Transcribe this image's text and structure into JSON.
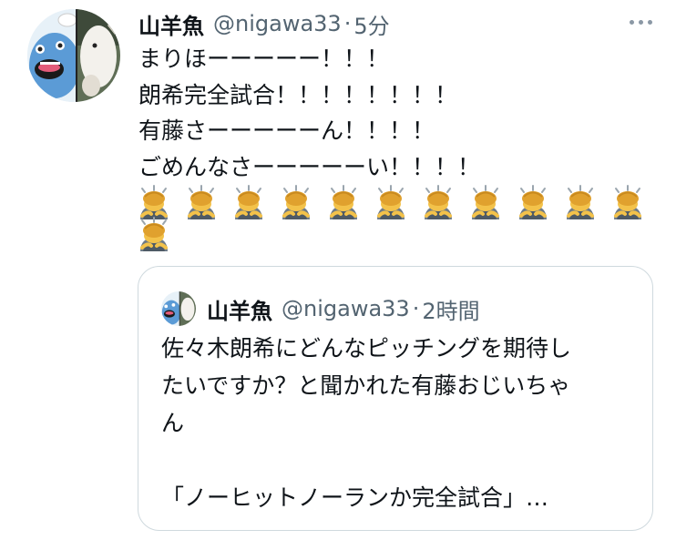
{
  "tweet": {
    "author_name": "山羊魚",
    "handle": "@nigawa33",
    "separator": "·",
    "time": "5分",
    "lines": [
      "まりほーーーーー！！！",
      "朗希完全試合！！！！！！！！",
      "有藤さーーーーーん！！！！",
      "ごめんなさーーーーーい！！！！"
    ],
    "emoji": "person-bowing-emoji",
    "emoji_count": 12
  },
  "quoted_tweet": {
    "author_name": "山羊魚",
    "handle": "@nigawa33",
    "separator": "·",
    "time": "2時間",
    "lines": [
      "佐々木朗希にどんなピッチングを期待し",
      "たいですか？と聞かれた有藤おじいちゃ",
      "ん",
      "",
      "「ノーヒットノーランか完全試合」…"
    ]
  },
  "icons": {
    "more": "more-horizontal-icon",
    "avatar": "fish-and-goat-avatar"
  },
  "colors": {
    "text": "#0f1419",
    "secondary": "#536471",
    "border": "#cfd9de",
    "avatar_fish": "#5b9bd6"
  }
}
